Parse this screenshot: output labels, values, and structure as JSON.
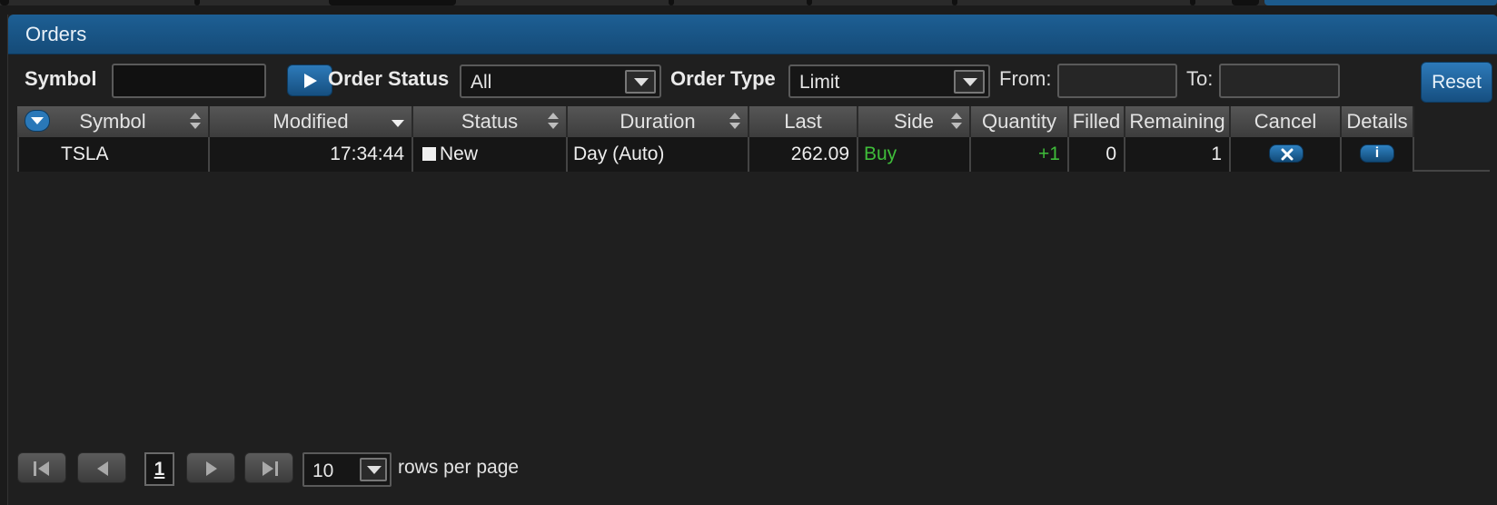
{
  "panel": {
    "title": "Orders"
  },
  "filters": {
    "symbol_label": "Symbol",
    "symbol_value": "",
    "order_status_label": "Order Status",
    "order_status_value": "All",
    "order_type_label": "Order Type",
    "order_type_value": "Limit",
    "from_label": "From:",
    "from_value": "",
    "to_label": "To:",
    "to_value": "",
    "reset_label": "Reset"
  },
  "table": {
    "columns": [
      "Symbol",
      "Modified",
      "Status",
      "Duration",
      "Last",
      "Side",
      "Quantity",
      "Filled",
      "Remaining",
      "Cancel",
      "Details"
    ],
    "rows": [
      {
        "symbol": "TSLA",
        "modified": "17:34:44",
        "status": "New",
        "duration": "Day (Auto)",
        "last": "262.09",
        "side": "Buy",
        "quantity": "+1",
        "filled": "0",
        "remaining": "1",
        "cancel_icon": "close-icon",
        "details_icon": "info-icon",
        "details_glyph": "i"
      }
    ]
  },
  "pager": {
    "current_page": "1",
    "rows_per_page": "10",
    "rows_label": "rows per page"
  },
  "colors": {
    "titlebar": "#1a5a8e",
    "buy_green": "#3fbd3a",
    "button_blue": "#1f649c"
  }
}
